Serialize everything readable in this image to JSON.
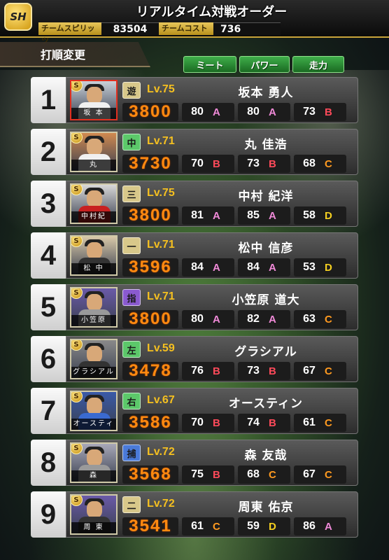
{
  "header": {
    "logo": "SH",
    "title": "リアルタイム対戦オーダー",
    "team_spirit_label": "チームスピリッツ",
    "team_spirit_value": "83504",
    "team_cost_label": "チームコスト",
    "team_cost_value": "736"
  },
  "section_title": "打順変更",
  "sort_buttons": [
    "ミート",
    "パワー",
    "走力"
  ],
  "grade_colors": {
    "A": "#f08ad8",
    "B": "#ff4a5a",
    "C": "#ff9a20",
    "D": "#f5d020"
  },
  "lineup": [
    {
      "order": "1",
      "position": "遊",
      "pos_color": "#d8c88a",
      "level": "Lv.75",
      "name": "坂本 勇人",
      "tag": "坂 本",
      "power": "3800",
      "meet": "80",
      "meet_grade": "A",
      "pow": "80",
      "pow_grade": "A",
      "speed": "73",
      "speed_grade": "B",
      "selected": true,
      "uniform": "orange",
      "bg": "#c8d0d8"
    },
    {
      "order": "2",
      "position": "中",
      "pos_color": "#5cc86a",
      "level": "Lv.71",
      "name": "丸 佳浩",
      "tag": "丸",
      "power": "3730",
      "meet": "70",
      "meet_grade": "B",
      "pow": "73",
      "pow_grade": "B",
      "speed": "68",
      "speed_grade": "C",
      "selected": false,
      "uniform": "orange",
      "bg": "#d08a50"
    },
    {
      "order": "3",
      "position": "三",
      "pos_color": "#d8c88a",
      "level": "Lv.75",
      "name": "中村 紀洋",
      "tag": "中村紀",
      "power": "3800",
      "meet": "81",
      "meet_grade": "A",
      "pow": "85",
      "pow_grade": "A",
      "speed": "58",
      "speed_grade": "D",
      "selected": false,
      "uniform": "red",
      "bg": "#d8d8d8"
    },
    {
      "order": "4",
      "position": "一",
      "pos_color": "#d8c88a",
      "level": "Lv.71",
      "name": "松中 信彦",
      "tag": "松 中",
      "power": "3596",
      "meet": "84",
      "meet_grade": "A",
      "pow": "84",
      "pow_grade": "A",
      "speed": "53",
      "speed_grade": "D",
      "selected": false,
      "uniform": "black",
      "bg": "#d8c8a8"
    },
    {
      "order": "5",
      "position": "指",
      "pos_color": "#8a5ad0",
      "level": "Lv.71",
      "name": "小笠原 道大",
      "tag": "小笠原",
      "power": "3800",
      "meet": "80",
      "meet_grade": "A",
      "pow": "82",
      "pow_grade": "A",
      "speed": "63",
      "speed_grade": "C",
      "selected": false,
      "uniform": "grey",
      "bg": "#6a5aa8"
    },
    {
      "order": "6",
      "position": "左",
      "pos_color": "#5cc86a",
      "level": "Lv.59",
      "name": "グラシアル",
      "tag": "グラシアル",
      "power": "3478",
      "meet": "76",
      "meet_grade": "B",
      "pow": "73",
      "pow_grade": "B",
      "speed": "67",
      "speed_grade": "C",
      "selected": false,
      "uniform": "black",
      "bg": "#8a8a8a"
    },
    {
      "order": "7",
      "position": "右",
      "pos_color": "#5cc86a",
      "level": "Lv.67",
      "name": "オースティン",
      "tag": "オースティン",
      "power": "3586",
      "meet": "70",
      "meet_grade": "B",
      "pow": "74",
      "pow_grade": "B",
      "speed": "61",
      "speed_grade": "C",
      "selected": false,
      "uniform": "blue",
      "bg": "#3a5aa8"
    },
    {
      "order": "8",
      "position": "捕",
      "pos_color": "#4a7ad8",
      "level": "Lv.72",
      "name": "森 友哉",
      "tag": "森",
      "power": "3568",
      "meet": "75",
      "meet_grade": "B",
      "pow": "68",
      "pow_grade": "C",
      "speed": "67",
      "speed_grade": "C",
      "selected": false,
      "uniform": "grey",
      "bg": "#a8a8b8"
    },
    {
      "order": "9",
      "position": "二",
      "pos_color": "#d8c88a",
      "level": "Lv.72",
      "name": "周東 佑京",
      "tag": "周 東",
      "power": "3541",
      "meet": "61",
      "meet_grade": "C",
      "pow": "59",
      "pow_grade": "D",
      "speed": "86",
      "speed_grade": "A",
      "selected": false,
      "uniform": "black",
      "bg": "#6a5aa8"
    }
  ]
}
